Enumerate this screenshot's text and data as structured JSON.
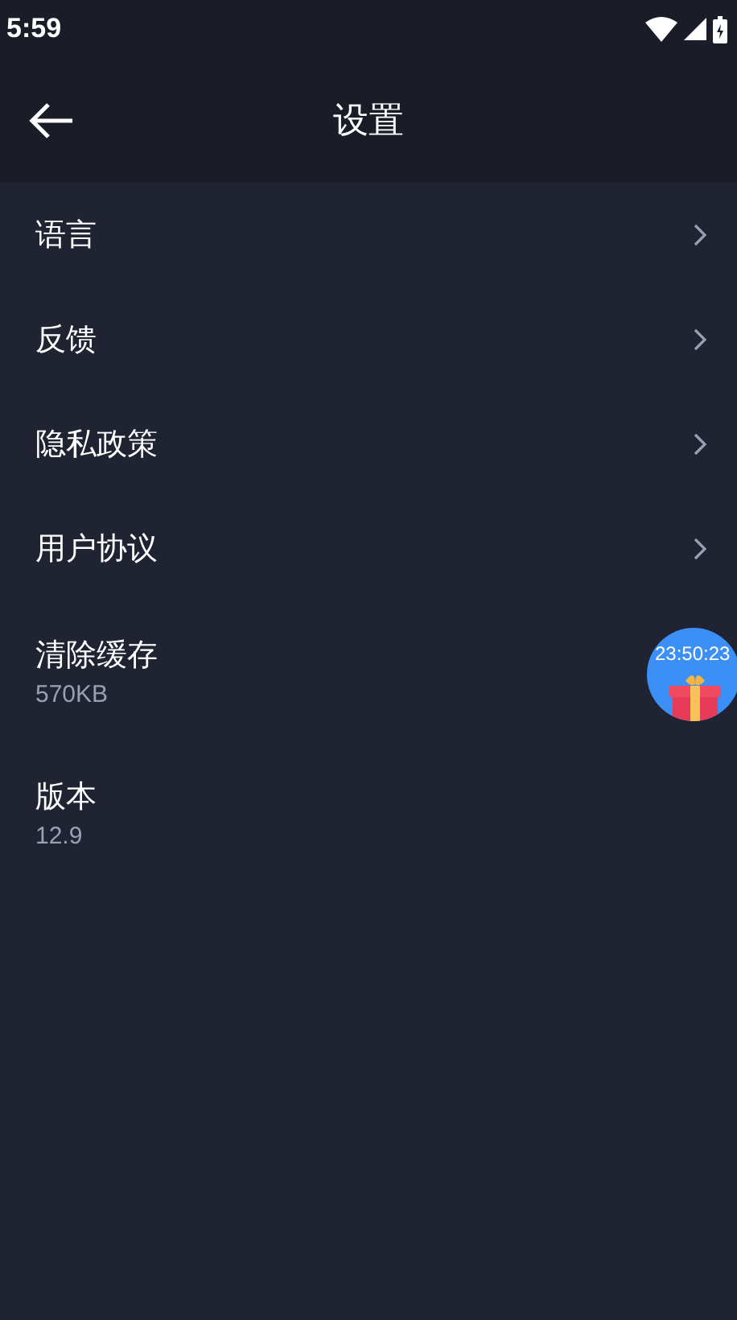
{
  "status_bar": {
    "time": "5:59"
  },
  "toolbar": {
    "title": "设置"
  },
  "items": [
    {
      "kind": "link",
      "label": "语言"
    },
    {
      "kind": "link",
      "label": "反馈"
    },
    {
      "kind": "link",
      "label": "隐私政策"
    },
    {
      "kind": "link",
      "label": "用户协议"
    },
    {
      "kind": "info",
      "label": "清除缓存",
      "value": "570KB"
    },
    {
      "kind": "info",
      "label": "版本",
      "value": "12.9"
    }
  ],
  "floating_gift": {
    "timer": "23:50:23"
  }
}
